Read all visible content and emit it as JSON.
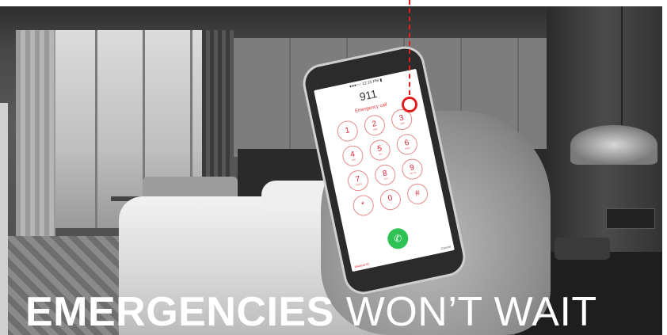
{
  "headline": {
    "emphasis": "EMERGENCIES",
    "rest": "WON’T WAIT"
  },
  "phone_screen": {
    "dialed_number": "911",
    "status_label": "Emergency call",
    "keys": [
      {
        "digit": "1",
        "letters": ""
      },
      {
        "digit": "2",
        "letters": "ABC"
      },
      {
        "digit": "3",
        "letters": "DEF"
      },
      {
        "digit": "4",
        "letters": "GHI"
      },
      {
        "digit": "5",
        "letters": "JKL"
      },
      {
        "digit": "6",
        "letters": "MNO"
      },
      {
        "digit": "7",
        "letters": "PQRS"
      },
      {
        "digit": "8",
        "letters": "TUV"
      },
      {
        "digit": "9",
        "letters": "WXYZ"
      },
      {
        "digit": "*",
        "letters": ""
      },
      {
        "digit": "0",
        "letters": "+"
      },
      {
        "digit": "#",
        "letters": ""
      }
    ],
    "footer_left": "Medical ID",
    "footer_right": "Cancel",
    "call_icon": "phone-handset-icon"
  },
  "colors": {
    "callout_red": "#e02020",
    "call_green": "#2ec255",
    "headline_white": "#ffffff"
  }
}
